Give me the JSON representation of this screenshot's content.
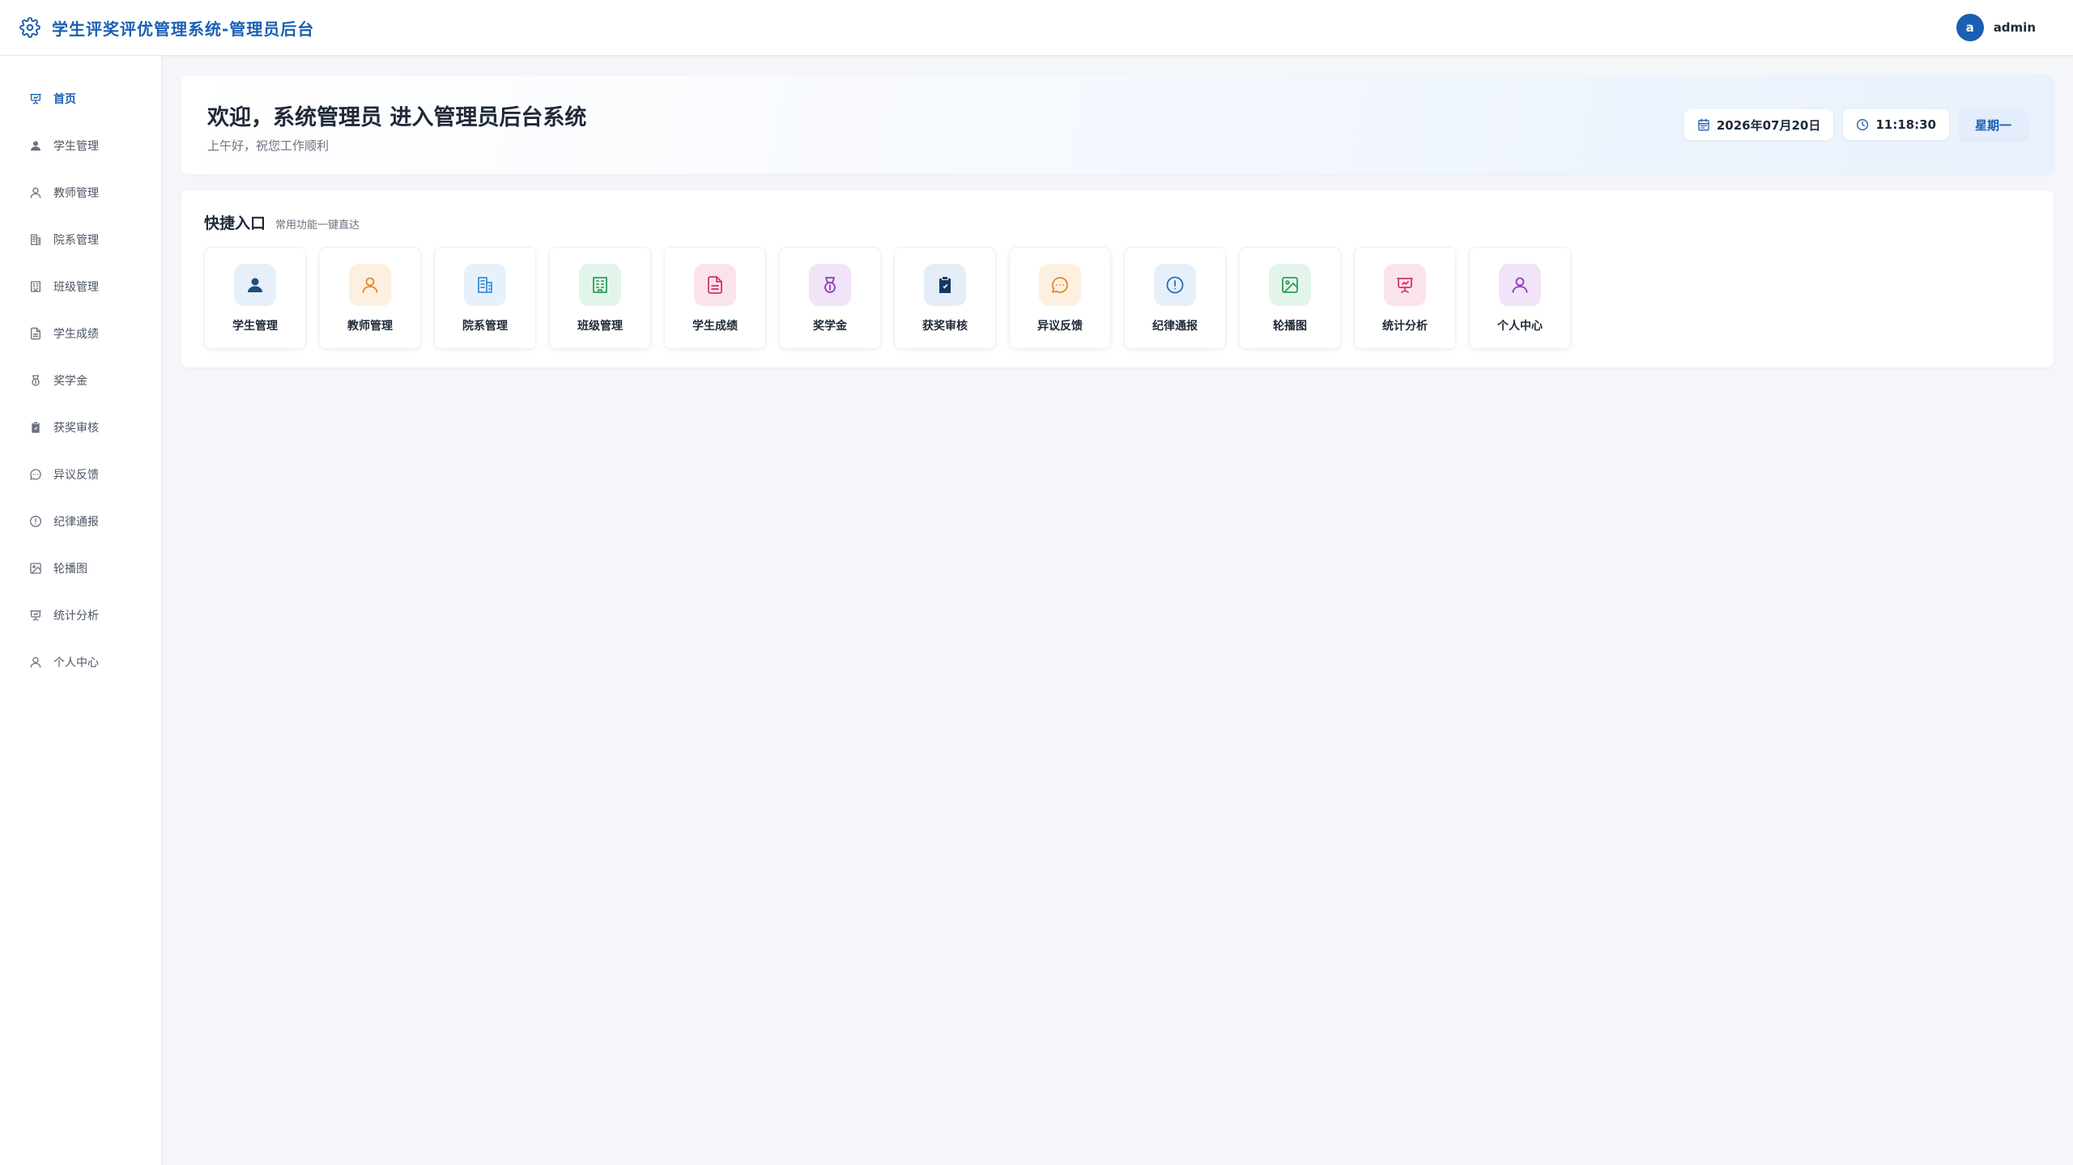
{
  "header": {
    "title": "学生评奖评优管理系统-管理员后台",
    "avatar_letter": "a",
    "username": "admin"
  },
  "sidebar": {
    "items": [
      {
        "label": "首页",
        "icon": "presentation-icon",
        "active": true
      },
      {
        "label": "学生管理",
        "icon": "user-solid-icon"
      },
      {
        "label": "教师管理",
        "icon": "user-outline-icon"
      },
      {
        "label": "院系管理",
        "icon": "building-icon"
      },
      {
        "label": "班级管理",
        "icon": "office-icon"
      },
      {
        "label": "学生成绩",
        "icon": "document-icon"
      },
      {
        "label": "奖学金",
        "icon": "medal-icon"
      },
      {
        "label": "获奖审核",
        "icon": "clipboard-check-icon"
      },
      {
        "label": "异议反馈",
        "icon": "chat-icon"
      },
      {
        "label": "纪律通报",
        "icon": "alert-circle-icon"
      },
      {
        "label": "轮播图",
        "icon": "image-icon"
      },
      {
        "label": "统计分析",
        "icon": "presentation-icon"
      },
      {
        "label": "个人中心",
        "icon": "user-outline-icon"
      }
    ]
  },
  "welcome": {
    "title": "欢迎，系统管理员 进入管理员后台系统",
    "subtitle": "上午好，祝您工作顺利",
    "date": "2026年07月20日",
    "time": "11:18:30",
    "weekday": "星期一"
  },
  "quick": {
    "title": "快捷入口",
    "subtitle": "常用功能一键直达",
    "cards": [
      {
        "label": "学生管理",
        "icon": "user-solid-icon",
        "color": "#1f4e79",
        "bg": "#e6f0fb"
      },
      {
        "label": "教师管理",
        "icon": "user-outline-icon",
        "color": "#e08a2c",
        "bg": "#fdf0e1"
      },
      {
        "label": "院系管理",
        "icon": "building-icon",
        "color": "#3a8fd9",
        "bg": "#e6f1fb"
      },
      {
        "label": "班级管理",
        "icon": "office-icon",
        "color": "#2e9d5b",
        "bg": "#e3f5ea"
      },
      {
        "label": "学生成绩",
        "icon": "document-icon",
        "color": "#d1336e",
        "bg": "#fbe3ec"
      },
      {
        "label": "奖学金",
        "icon": "medal-icon",
        "color": "#8e3fb0",
        "bg": "#f1e3f8"
      },
      {
        "label": "获奖审核",
        "icon": "clipboard-check-icon",
        "color": "#17385f",
        "bg": "#e4edf8"
      },
      {
        "label": "异议反馈",
        "icon": "chat-icon",
        "color": "#e08a2c",
        "bg": "#fdf0e1"
      },
      {
        "label": "纪律通报",
        "icon": "alert-circle-icon",
        "color": "#2b6cb0",
        "bg": "#e6f0fb"
      },
      {
        "label": "轮播图",
        "icon": "image-icon",
        "color": "#2e9d5b",
        "bg": "#e3f5ea"
      },
      {
        "label": "统计分析",
        "icon": "presentation-icon",
        "color": "#d1336e",
        "bg": "#fbe3ec"
      },
      {
        "label": "个人中心",
        "icon": "user-outline-icon",
        "color": "#8e3fb0",
        "bg": "#f1e3f8"
      }
    ]
  },
  "colors": {
    "accent": "#1a5fb4",
    "background": "#f4f6fa"
  }
}
